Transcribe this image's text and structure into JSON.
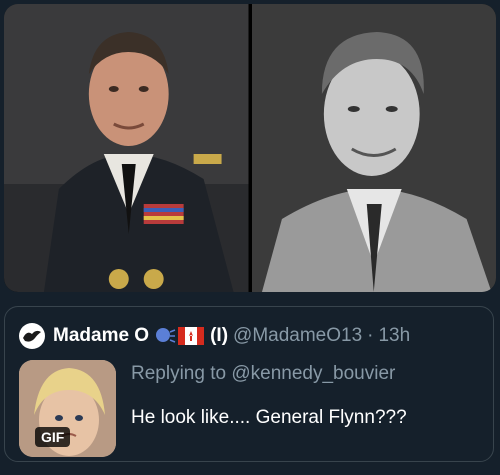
{
  "media": {
    "left_photo": "military-officer-photo",
    "right_photo": "vintage-portrait-photo"
  },
  "quoted_tweet": {
    "display_name": "Madame O",
    "name_suffix_emoji": "🗣️🇨🇦",
    "name_suffix_text": "(I)",
    "handle": "@MadameO13",
    "separator": "·",
    "time": "13h",
    "replying_prefix": "Replying to ",
    "replying_handle": "@kennedy_bouvier",
    "text": "He look like.... General Flynn???",
    "media_badge": "GIF"
  },
  "colors": {
    "background": "#15202b",
    "border": "#38444d",
    "secondary_text": "#8899a6"
  }
}
